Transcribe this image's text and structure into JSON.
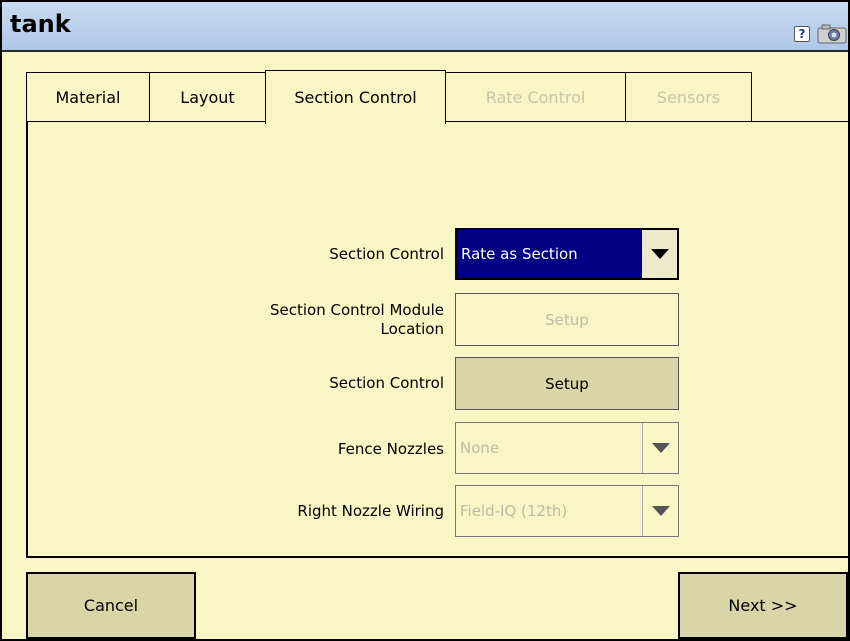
{
  "window": {
    "title": "tank"
  },
  "tabs": [
    {
      "label": "Material",
      "state": "normal"
    },
    {
      "label": "Layout",
      "state": "normal"
    },
    {
      "label": "Section Control",
      "state": "active"
    },
    {
      "label": "Rate Control",
      "state": "disabled"
    },
    {
      "label": "Sensors",
      "state": "disabled"
    }
  ],
  "form": {
    "section_control": {
      "label": "Section Control",
      "value": "Rate as Section"
    },
    "module_location": {
      "label_line1": "Section Control Module",
      "label_line2": "Location",
      "button": "Setup"
    },
    "section_control_setup": {
      "label": "Section Control",
      "button": "Setup"
    },
    "fence_nozzles": {
      "label": "Fence Nozzles",
      "value": "None"
    },
    "right_nozzle_wiring": {
      "label": "Right Nozzle Wiring",
      "value": "Field-IQ (12th)"
    }
  },
  "footer": {
    "cancel": "Cancel",
    "next": "Next >>"
  },
  "icons": {
    "help": "help-icon",
    "camera": "camera-icon",
    "dropdown": "chevron-down-icon"
  },
  "colors": {
    "background": "#f8f6c4",
    "titlebar": "#b9cfec",
    "selected_field": "#000080",
    "button": "#d8d5a6"
  }
}
